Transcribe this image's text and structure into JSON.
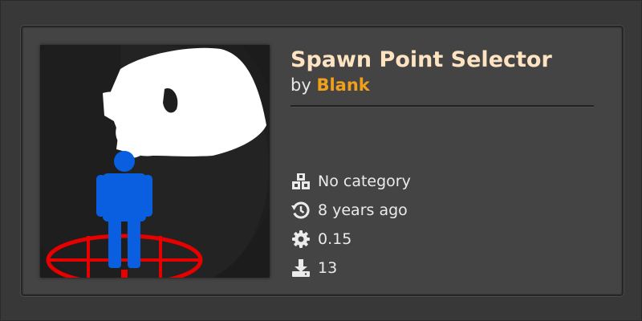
{
  "addon": {
    "title": "Spawn Point Selector",
    "by_prefix": "by",
    "author": "Blank",
    "category": "No category",
    "updated": "8 years ago",
    "version": "0.15",
    "downloads": "13"
  },
  "icons": {
    "category": "cubes-icon",
    "updated": "history-icon",
    "version": "gear-icon",
    "downloads": "download-icon"
  },
  "colors": {
    "title": "#fde3c2",
    "author": "#f0a01a",
    "text": "#ebebeb"
  }
}
